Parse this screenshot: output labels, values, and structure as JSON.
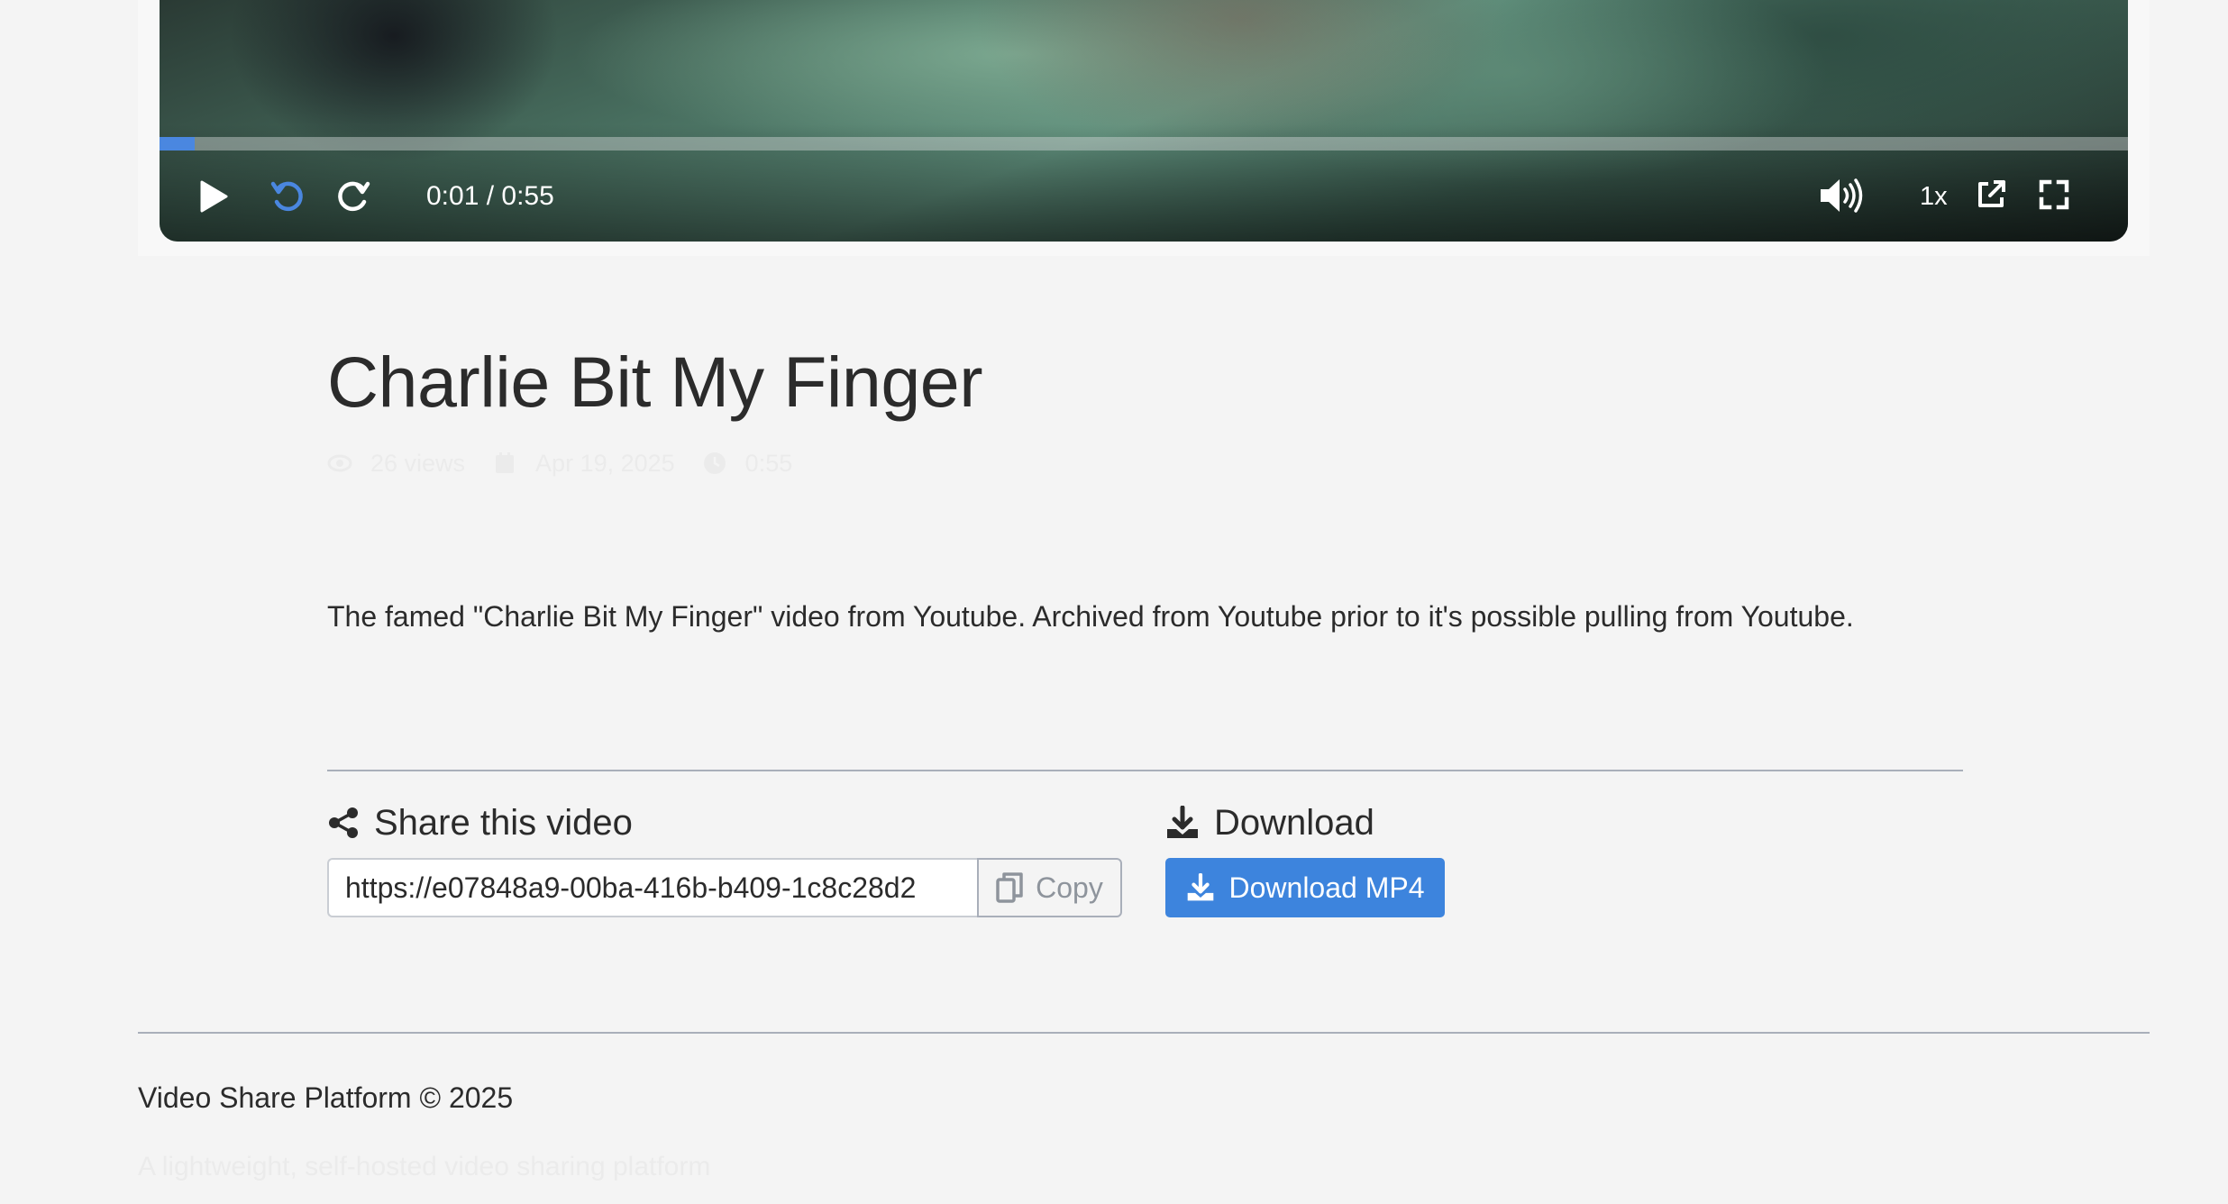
{
  "player": {
    "current_time": "0:01",
    "duration": "0:55",
    "time_display": "0:01 / 0:55",
    "progress_fraction": 0.018,
    "speed": "1x",
    "accent_color": "#4a87e0"
  },
  "video": {
    "title": "Charlie Bit My Finger",
    "views": "26 views",
    "date": "Apr 19, 2025",
    "duration_meta": "0:55",
    "description": "The famed \"Charlie Bit My Finger\" video from Youtube. Archived from Youtube prior to it's possible pulling from Youtube."
  },
  "share": {
    "heading": "Share this video",
    "url": "https://e07848a9-00ba-416b-b409-1c8c28d2",
    "copy_label": "Copy"
  },
  "download": {
    "heading": "Download",
    "button_label": "Download MP4",
    "button_color": "#3d84dd"
  },
  "footer": {
    "copyright": "Video Share Platform © 2025",
    "tagline": "A lightweight, self-hosted video sharing platform"
  },
  "icons": {
    "play": "play-icon",
    "rewind": "rewind-icon",
    "forward": "forward-icon",
    "volume": "volume-icon",
    "popout": "external-link-icon",
    "fullscreen": "fullscreen-icon",
    "share": "share-icon",
    "download": "download-icon",
    "copy": "copy-icon",
    "eye": "eye-icon",
    "calendar": "calendar-icon",
    "clock": "clock-icon"
  }
}
